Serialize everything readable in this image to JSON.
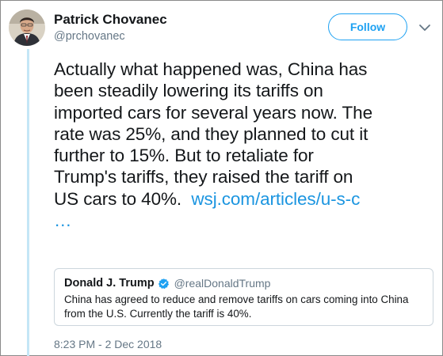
{
  "author": {
    "name": "Patrick Chovanec",
    "handle": "@prchovanec",
    "avatar_icon": "profile-photo"
  },
  "follow_button": {
    "label": "Follow",
    "color": "#1da1f2"
  },
  "menu": {
    "icon": "chevron-down-icon"
  },
  "tweet": {
    "lines": [
      "Actually what happened was, China has",
      "been steadily lowering its tariffs on",
      "imported cars for several years now. The",
      "rate was 25%, and they planned to cut it",
      "further to 15%. But to retaliate for",
      "Trump's tariffs, they raised the tariff on",
      "US cars to 40%."
    ],
    "link": "wsj.com/articles/u-s-c",
    "link_ellipsis": "…",
    "link_color": "#1b95e0"
  },
  "quoted_tweet": {
    "name": "Donald J. Trump",
    "handle": "@realDonaldTrump",
    "verified_icon": "verified-badge-icon",
    "lines": [
      "China has agreed to reduce and remove tariffs on cars coming into China",
      "from the U.S. Currently the tariff is 40%."
    ]
  },
  "timestamp": "8:23 PM - 2 Dec 2018",
  "colors": {
    "thread_line": "#c4e6f6",
    "text": "#14171a",
    "secondary": "#657786",
    "border": "#ccd6dd"
  }
}
